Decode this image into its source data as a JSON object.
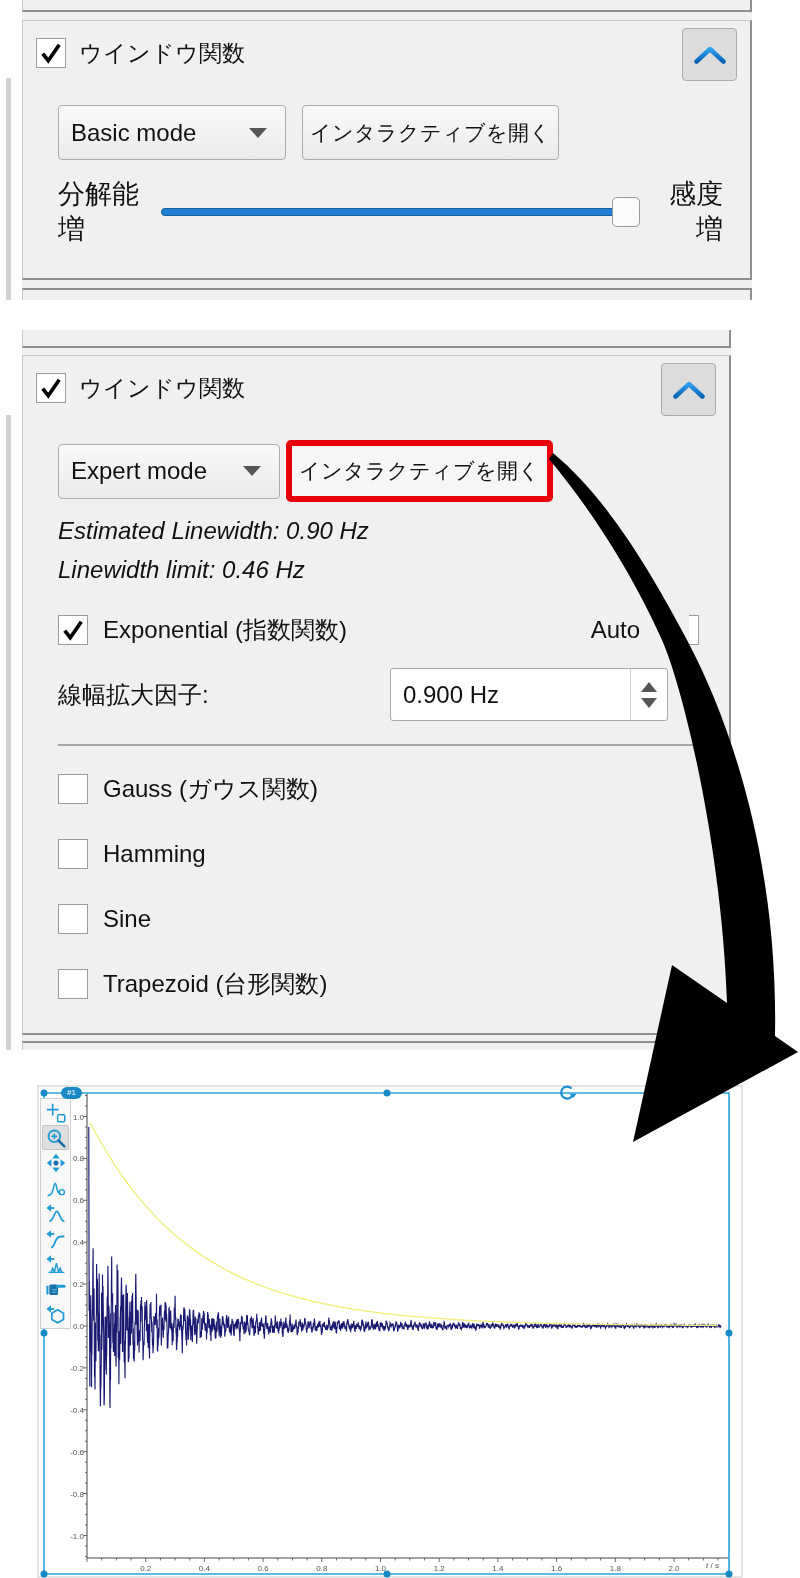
{
  "panels": [
    {
      "title": "ウインドウ関数",
      "checked": true,
      "expanded": true,
      "mode": "Basic mode",
      "button": {
        "label": "インタラクティブを開く",
        "highlighted": false
      },
      "slider": {
        "left_label": "分解能増",
        "right_label": "感度増",
        "level": 0.97
      }
    },
    {
      "title": "ウインドウ関数",
      "checked": true,
      "expanded": true,
      "mode": "Expert mode",
      "button": {
        "label": "インタラクティブを開く",
        "highlighted": true
      },
      "info": [
        "Estimated Linewidth: 0.90 Hz",
        "Linewidth limit: 0.46 Hz"
      ],
      "functions": [
        {
          "label": "Exponential (指数関数)",
          "checked": true,
          "auto": {
            "label": "Auto",
            "checked": false
          },
          "parameter": {
            "label": "線幅拡大因子:",
            "value": "0.900 Hz"
          }
        },
        {
          "label": "Gauss (ガウス関数)",
          "checked": false
        },
        {
          "label": "Hamming",
          "checked": false
        },
        {
          "label": "Sine",
          "checked": false
        },
        {
          "label": "Trapezoid (台形関数)",
          "checked": false
        }
      ]
    }
  ],
  "plot": {
    "badge": "#1",
    "tools": [
      {
        "selected": false
      },
      {
        "selected": true
      },
      {
        "selected": false
      },
      {
        "selected": false
      },
      {
        "selected": false
      },
      {
        "selected": false
      },
      {
        "selected": false
      },
      {
        "selected": false
      },
      {
        "selected": false
      }
    ],
    "yticks": [
      "1.0",
      "0.8",
      "0.6",
      "0.4",
      "0.2",
      "0.0",
      "-0.2",
      "-0.4",
      "-0.6",
      "-0.8",
      "-1.0"
    ],
    "xticks": [
      "0.2",
      "0.4",
      "0.6",
      "0.8",
      "1.0",
      "1.2",
      "1.4",
      "1.6",
      "1.8",
      "2.0"
    ],
    "xlabel": "*t* / s"
  }
}
